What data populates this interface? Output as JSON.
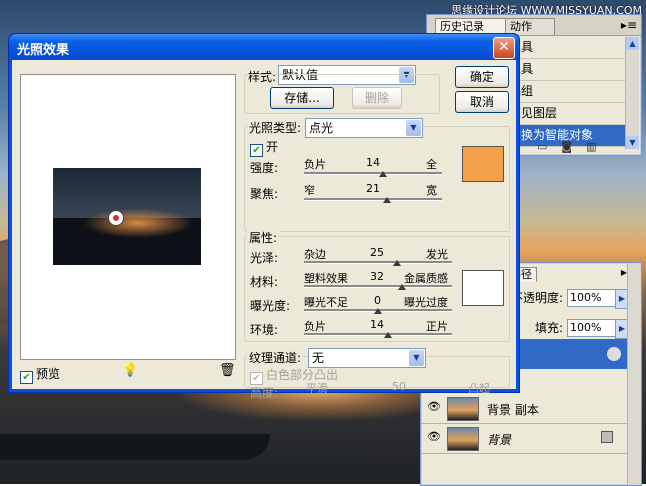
{
  "watermark": "思缘设计论坛 WWW.MISSYUAN.COM",
  "history_panel": {
    "tabs": [
      "历史记录",
      "动作"
    ],
    "items": [
      "工具",
      "工具",
      "编组",
      "可见图层",
      "转换为智能对象"
    ],
    "selected_index": 4
  },
  "layers_panel": {
    "tab": "路径",
    "opacity_label": "不透明度:",
    "opacity_value": "100%",
    "fill_label": "填充:",
    "fill_value": "100%",
    "layers": [
      "背景 副本",
      "背景"
    ]
  },
  "dialog": {
    "title": "光照效果",
    "style_label": "样式:",
    "style_value": "默认值",
    "save_button": "存储...",
    "delete_button": "删除",
    "ok_button": "确定",
    "cancel_button": "取消",
    "preview_label": "预览",
    "light_type_label": "光照类型:",
    "light_type_value": "点光",
    "on_label": "开",
    "intensity": {
      "label": "强度:",
      "left": "负片",
      "value": "14",
      "right": "全",
      "min": -100,
      "max": 100
    },
    "focus": {
      "label": "聚焦:",
      "left": "窄",
      "value": "21",
      "right": "宽",
      "min": -100,
      "max": 100
    },
    "properties_label": "属性:",
    "gloss": {
      "label": "光泽:",
      "left": "杂边",
      "value": "25",
      "right": "发光",
      "min": -100,
      "max": 100
    },
    "material": {
      "label": "材料:",
      "left": "塑料效果",
      "value": "32",
      "right": "金属质感",
      "min": -100,
      "max": 100
    },
    "exposure": {
      "label": "曝光度:",
      "left": "曝光不足",
      "value": "0",
      "right": "曝光过度",
      "min": -100,
      "max": 100
    },
    "ambience": {
      "label": "环境:",
      "left": "负片",
      "value": "14",
      "right": "正片",
      "min": -100,
      "max": 100
    },
    "texture_label": "纹理通道:",
    "texture_value": "无",
    "white_high_label": "白色部分凸出",
    "height": {
      "label": "高度:",
      "left": "平滑",
      "value": "50",
      "right": "凸起",
      "min": 0,
      "max": 100
    },
    "light_color": "#f2a04a",
    "property_color": "#ffffff"
  }
}
